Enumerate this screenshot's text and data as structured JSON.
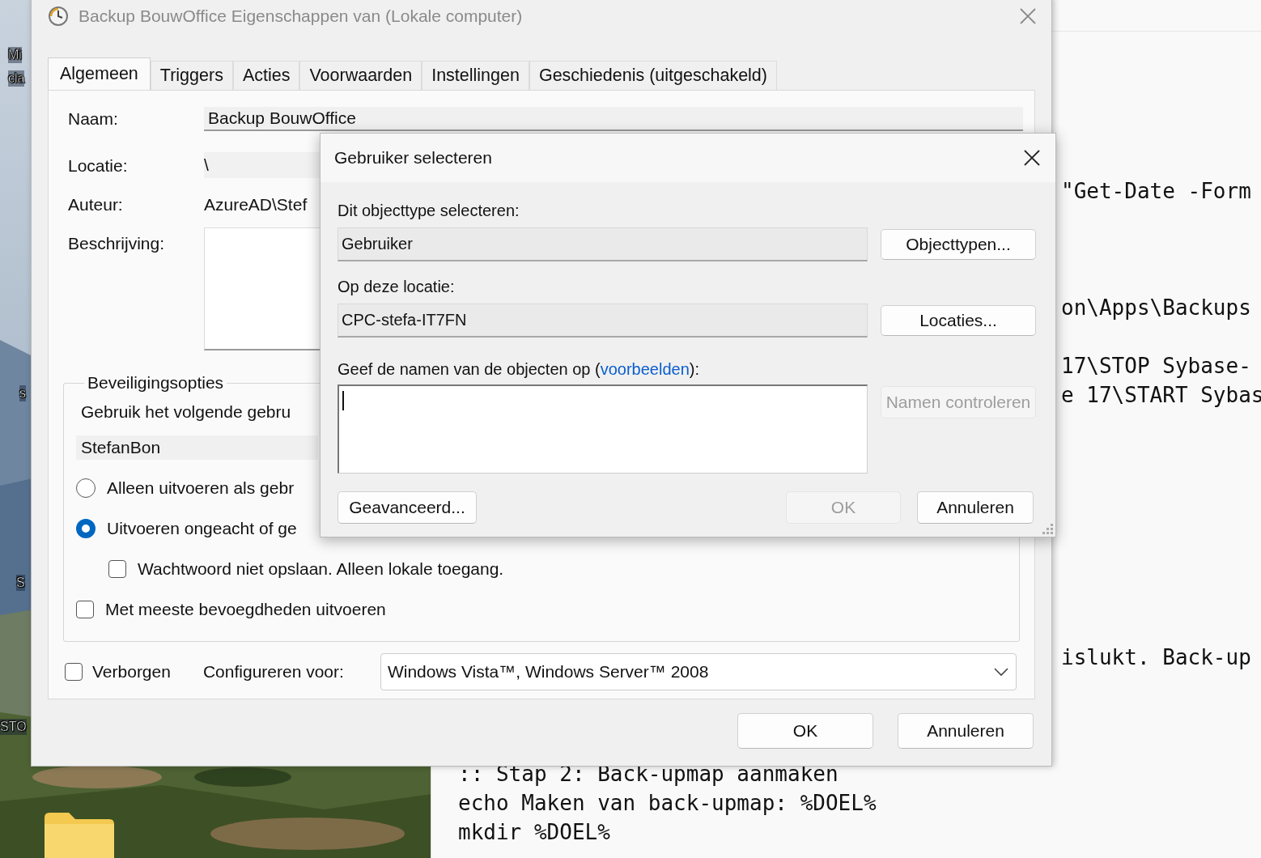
{
  "desktop": {
    "icon_labels": [
      "Mi",
      "cla",
      "s",
      "S",
      "STO"
    ]
  },
  "editor": {
    "lines": [
      {
        "text": "\"Get-Date -Form"
      },
      {
        "text": "on\\Apps\\Backups"
      },
      {
        "text": "17\\STOP Sybase-"
      },
      {
        "text": "e 17\\START Sybas"
      },
      {
        "text": "islukt. Back-up"
      },
      {
        "text": ":: Stap 2: Back-upmap aanmaken"
      },
      {
        "text": "echo Maken van back-upmap: %DOEL%"
      },
      {
        "text": "mkdir %DOEL%"
      }
    ]
  },
  "task_dialog": {
    "title": "Backup BouwOffice Eigenschappen van (Lokale computer)",
    "tabs": [
      {
        "label": "Algemeen",
        "selected": true
      },
      {
        "label": "Triggers",
        "selected": false
      },
      {
        "label": "Acties",
        "selected": false
      },
      {
        "label": "Voorwaarden",
        "selected": false
      },
      {
        "label": "Instellingen",
        "selected": false
      },
      {
        "label": "Geschiedenis (uitgeschakeld)",
        "selected": false
      }
    ],
    "fields": [
      {
        "kind": "input",
        "label": "Naam:",
        "value": "Backup BouwOffice"
      },
      {
        "kind": "readonly",
        "label": "Locatie:",
        "value": "\\"
      },
      {
        "kind": "text",
        "label": "Auteur:",
        "value": "AzureAD\\Stef"
      },
      {
        "kind": "textarea",
        "label": "Beschrijving:"
      }
    ],
    "security": {
      "title": "Beveiligingsopties",
      "user_prompt": "Gebruik het volgende gebru",
      "user": "StefanBon",
      "options": [
        {
          "kind": "radio",
          "label": "Alleen uitvoeren als gebr",
          "selected": false
        },
        {
          "kind": "radio",
          "label": "Uitvoeren ongeacht of ge",
          "selected": true,
          "children": [
            {
              "kind": "checkbox",
              "label": "Wachtwoord niet opslaan. Alleen lokale toegang.",
              "checked": false
            }
          ]
        },
        {
          "kind": "checkbox",
          "label": "Met meeste bevoegdheden uitvoeren",
          "checked": false
        }
      ]
    },
    "hidden": {
      "label": "Verborgen",
      "checked": false
    },
    "configure": {
      "label": "Configureren voor:",
      "value": "Windows Vista™, Windows Server™ 2008"
    },
    "buttons": [
      "OK",
      "Annuleren"
    ]
  },
  "select_dialog": {
    "title": "Gebruiker selecteren",
    "object_type": {
      "label": "Dit objecttype selecteren:",
      "value": "Gebruiker",
      "button": "Objecttypen..."
    },
    "location": {
      "label": "Op deze locatie:",
      "value": "CPC-stefa-IT7FN",
      "button": "Locaties..."
    },
    "names": {
      "label_before": "Geef de namen van de objecten op (",
      "link": "voorbeelden",
      "label_after": "):",
      "check_button": {
        "label": "Namen controleren",
        "disabled": true
      }
    },
    "buttons": [
      {
        "label": "Geavanceerd...",
        "disabled": false
      },
      {
        "label": "OK",
        "disabled": true
      },
      {
        "label": "Annuleren",
        "disabled": false
      }
    ]
  }
}
